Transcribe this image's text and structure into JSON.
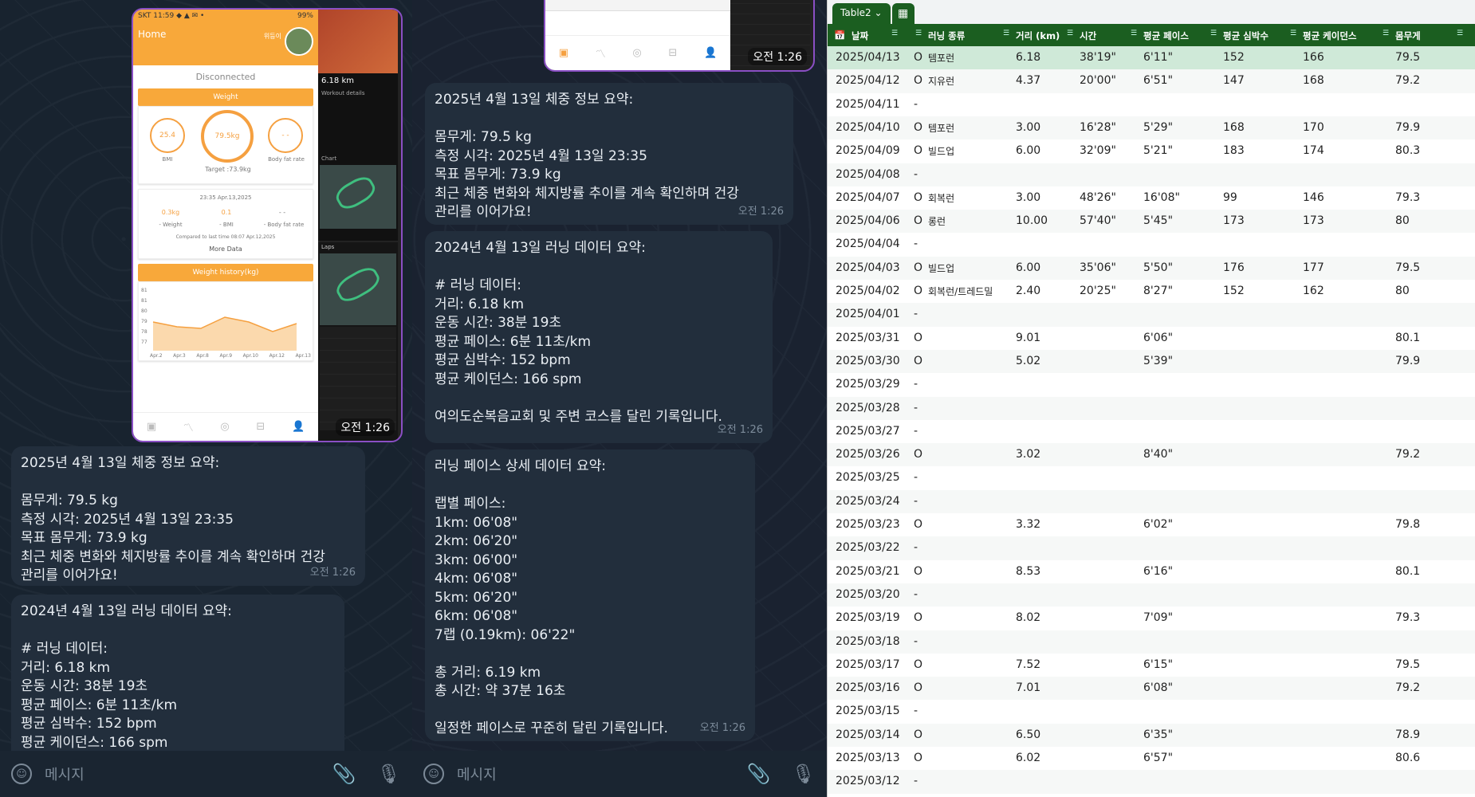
{
  "chat_left": {
    "phone_photo": {
      "status": "SKT 11:59 ◆ ▲ ✉ •",
      "battery": "99%",
      "home": "Home",
      "user": "위등이",
      "disconnected": "Disconnected",
      "weight_title": "Weight",
      "bmi_val": "25.4",
      "bmi_label": "BMI",
      "weight_val": "79.5kg",
      "fat_val": "- -",
      "fat_label": "Body fat rate",
      "target": "Target :73.9kg",
      "measured": "23:35 Apr.13,2025",
      "d_weight": "0.3kg",
      "d_bmi": "0.1",
      "d_fat": "- -",
      "l_weight": "- Weight",
      "l_bmi": "- BMI",
      "l_fat": "- Body fat rate",
      "compared": "Compared to last time 08:07 Apr.12,2025",
      "more": "More Data",
      "history_title": "Weight history(kg)",
      "y_ticks": [
        "81",
        "81",
        "80",
        "79",
        "78",
        "77"
      ],
      "x_ticks": [
        "Apr.2",
        "Apr.3",
        "Apr.8",
        "Apr.9",
        "Apr.10",
        "Apr.12",
        "Apr.13"
      ],
      "side_km": "6.18 km",
      "side_details": "Workout details",
      "side_chart": "Chart",
      "side_laps": "Laps",
      "time": "오전 1:26"
    },
    "bubble1": {
      "lines": [
        "2025년 4월 13일 체중 정보 요약:",
        "",
        "몸무게: 79.5 kg",
        "측정 시각: 2025년 4월 13일 23:35",
        "목표 몸무게: 73.9 kg",
        "최근 체중 변화와 체지방률 추이를 계속 확인하며 건강",
        "관리를 이어가요!"
      ],
      "time": "오전 1:26"
    },
    "bubble2": {
      "lines": [
        "2024년 4월 13일 러닝 데이터 요약:",
        "",
        "# 러닝 데이터:",
        "거리: 6.18 km",
        "운동 시간: 38분 19초",
        "평균 페이스: 6분 11초/km",
        "평균 심박수: 152 bpm",
        "평균 케이던스: 166 spm"
      ]
    },
    "input_placeholder": "메시지"
  },
  "chat_mid": {
    "photo_time": "오전 1:26",
    "bubble1": {
      "lines": [
        "2025년 4월 13일 체중 정보 요약:",
        "",
        "몸무게: 79.5 kg",
        "측정 시각: 2025년 4월 13일 23:35",
        "목표 몸무게: 73.9 kg",
        "최근 체중 변화와 체지방률 추이를 계속 확인하며 건강",
        "관리를 이어가요!"
      ],
      "time": "오전 1:26"
    },
    "bubble2": {
      "lines": [
        "2024년 4월 13일 러닝 데이터 요약:",
        "",
        "# 러닝 데이터:",
        "거리: 6.18 km",
        "운동 시간: 38분 19초",
        "평균 페이스: 6분 11초/km",
        "평균 심박수: 152 bpm",
        "평균 케이던스: 166 spm",
        "",
        "여의도순복음교회 및 주변 코스를 달린 기록입니다."
      ],
      "time": "오전 1:26"
    },
    "bubble3": {
      "lines": [
        "러닝 페이스 상세 데이터 요약:",
        "",
        "랩별 페이스:",
        "1km: 06'08\"",
        "2km: 06'20\"",
        "3km: 06'00\"",
        "4km: 06'08\"",
        "5km: 06'20\"",
        "6km: 06'08\"",
        "7랩 (0.19km): 06'22\"",
        "",
        "총 거리: 6.19 km",
        "총 시간: 약 37분 16초",
        "",
        "일정한 페이스로 꾸준히 달린 기록입니다."
      ],
      "time": "오전 1:26"
    },
    "input_placeholder": "메시지"
  },
  "sheet": {
    "tab_name": "Table2",
    "headers": [
      "날짜",
      "",
      "러닝 종류",
      "거리 (km)",
      "시간",
      "평균 페이스",
      "평균 심박수",
      "평균 케이던스",
      "몸무게"
    ],
    "rows": [
      [
        "2025/04/13",
        "O",
        "템포런",
        "6.18",
        "38'19\"",
        "6'11\"",
        "152",
        "166",
        "79.5"
      ],
      [
        "2025/04/12",
        "O",
        "지유런",
        "4.37",
        "20'00\"",
        "6'51\"",
        "147",
        "168",
        "79.2"
      ],
      [
        "2025/04/11",
        "-",
        "",
        "",
        "",
        "",
        "",
        "",
        ""
      ],
      [
        "2025/04/10",
        "O",
        "템포런",
        "3.00",
        "16'28\"",
        "5'29\"",
        "168",
        "170",
        "79.9"
      ],
      [
        "2025/04/09",
        "O",
        "빌드업",
        "6.00",
        "32'09\"",
        "5'21\"",
        "183",
        "174",
        "80.3"
      ],
      [
        "2025/04/08",
        "-",
        "",
        "",
        "",
        "",
        "",
        "",
        ""
      ],
      [
        "2025/04/07",
        "O",
        "회복런",
        "3.00",
        "48'26\"",
        "16'08\"",
        "99",
        "146",
        "79.3"
      ],
      [
        "2025/04/06",
        "O",
        "롱런",
        "10.00",
        "57'40\"",
        "5'45\"",
        "173",
        "173",
        "80"
      ],
      [
        "2025/04/04",
        "-",
        "",
        "",
        "",
        "",
        "",
        "",
        ""
      ],
      [
        "2025/04/03",
        "O",
        "빌드업",
        "6.00",
        "35'06\"",
        "5'50\"",
        "176",
        "177",
        "79.5"
      ],
      [
        "2025/04/02",
        "O",
        "회복런/트레드밀",
        "2.40",
        "20'25\"",
        "8'27\"",
        "152",
        "162",
        "80"
      ],
      [
        "2025/04/01",
        "-",
        "",
        "",
        "",
        "",
        "",
        "",
        ""
      ],
      [
        "2025/03/31",
        "O",
        "",
        "9.01",
        "",
        "6'06\"",
        "",
        "",
        "80.1"
      ],
      [
        "2025/03/30",
        "O",
        "",
        "5.02",
        "",
        "5'39\"",
        "",
        "",
        "79.9"
      ],
      [
        "2025/03/29",
        "-",
        "",
        "",
        "",
        "",
        "",
        "",
        ""
      ],
      [
        "2025/03/28",
        "-",
        "",
        "",
        "",
        "",
        "",
        "",
        ""
      ],
      [
        "2025/03/27",
        "-",
        "",
        "",
        "",
        "",
        "",
        "",
        ""
      ],
      [
        "2025/03/26",
        "O",
        "",
        "3.02",
        "",
        "8'40\"",
        "",
        "",
        "79.2"
      ],
      [
        "2025/03/25",
        "-",
        "",
        "",
        "",
        "",
        "",
        "",
        ""
      ],
      [
        "2025/03/24",
        "-",
        "",
        "",
        "",
        "",
        "",
        "",
        ""
      ],
      [
        "2025/03/23",
        "O",
        "",
        "3.32",
        "",
        "6'02\"",
        "",
        "",
        "79.8"
      ],
      [
        "2025/03/22",
        "-",
        "",
        "",
        "",
        "",
        "",
        "",
        ""
      ],
      [
        "2025/03/21",
        "O",
        "",
        "8.53",
        "",
        "6'16\"",
        "",
        "",
        "80.1"
      ],
      [
        "2025/03/20",
        "-",
        "",
        "",
        "",
        "",
        "",
        "",
        ""
      ],
      [
        "2025/03/19",
        "O",
        "",
        "8.02",
        "",
        "7'09\"",
        "",
        "",
        "79.3"
      ],
      [
        "2025/03/18",
        "-",
        "",
        "",
        "",
        "",
        "",
        "",
        ""
      ],
      [
        "2025/03/17",
        "O",
        "",
        "7.52",
        "",
        "6'15\"",
        "",
        "",
        "79.5"
      ],
      [
        "2025/03/16",
        "O",
        "",
        "7.01",
        "",
        "6'08\"",
        "",
        "",
        "79.2"
      ],
      [
        "2025/03/15",
        "-",
        "",
        "",
        "",
        "",
        "",
        "",
        ""
      ],
      [
        "2025/03/14",
        "O",
        "",
        "6.50",
        "",
        "6'35\"",
        "",
        "",
        "78.9"
      ],
      [
        "2025/03/13",
        "O",
        "",
        "6.02",
        "",
        "6'57\"",
        "",
        "",
        "80.6"
      ],
      [
        "2025/03/12",
        "-",
        "",
        "",
        "",
        "",
        "",
        "",
        ""
      ]
    ]
  },
  "colors": {
    "sheet_header": "#1b5e20",
    "selected_row": "#cfe9d8",
    "bubble": "#222e3c",
    "accent": "#f8a83a"
  }
}
